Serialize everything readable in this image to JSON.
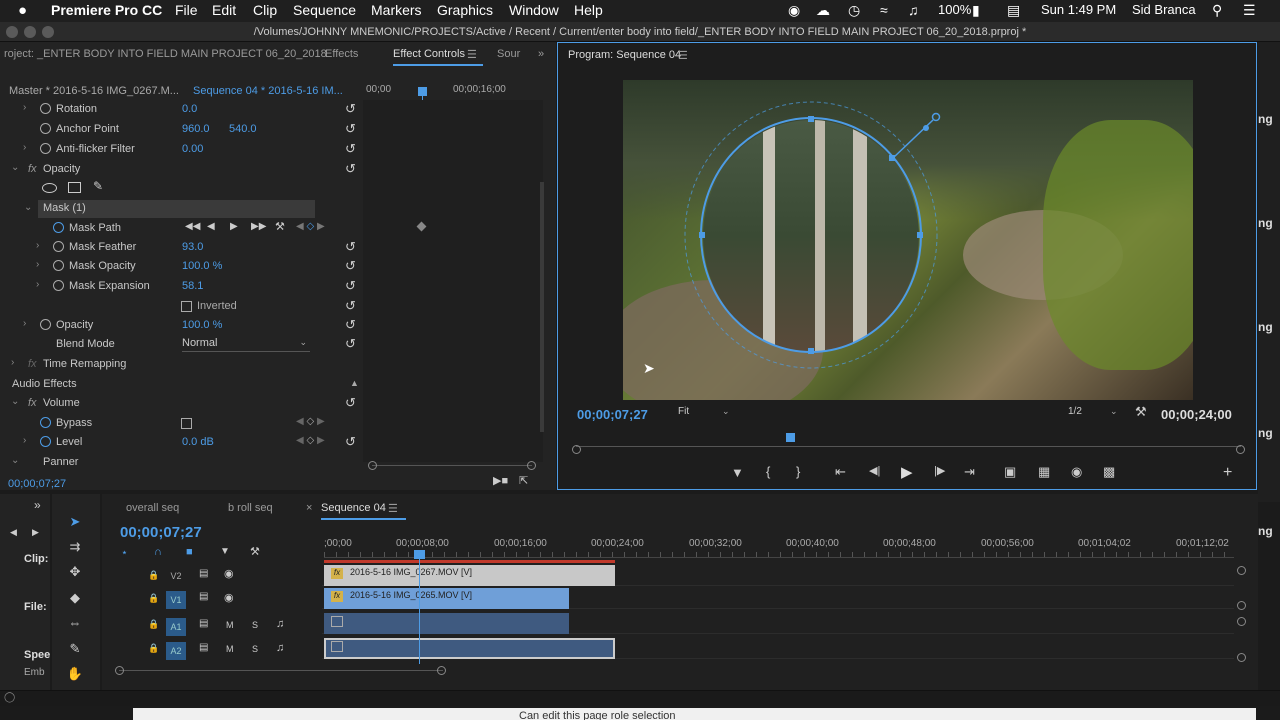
{
  "menubar": {
    "apple": "",
    "app": "Premiere Pro CC",
    "items": [
      "File",
      "Edit",
      "Clip",
      "Sequence",
      "Markers",
      "Graphics",
      "Window",
      "Help"
    ],
    "battery": "100%",
    "clock": "Sun 1:49 PM",
    "user": "Sid Branca"
  },
  "window": {
    "path": "/Volumes/JOHNNY MNEMONIC/PROJECTS/Active / Recent / Current/enter body into field/_ENTER BODY INTO FIELD MAIN PROJECT 06_20_2018.prproj *"
  },
  "left_tabs": {
    "project": "roject: _ENTER BODY INTO FIELD MAIN PROJECT 06_20_2018",
    "effects": "Effects",
    "effect_controls": "Effect Controls",
    "source": "Sour"
  },
  "ec": {
    "master": "Master * 2016-5-16 IMG_0267.M...",
    "sequence": "Sequence 04 * 2016-5-16 IM...",
    "ruler_start": "00;00",
    "ruler_mid": "00;00;16;00",
    "rotation_label": "Rotation",
    "rotation_val": "0.0",
    "anchor_label": "Anchor Point",
    "anchor_x": "960.0",
    "anchor_y": "540.0",
    "antiflicker_label": "Anti-flicker Filter",
    "antiflicker_val": "0.00",
    "opacity_fx_label": "Opacity",
    "mask_label": "Mask (1)",
    "mask_path_label": "Mask Path",
    "mask_feather_label": "Mask Feather",
    "mask_feather_val": "93.0",
    "mask_opacity_label": "Mask Opacity",
    "mask_opacity_val": "100.0 %",
    "mask_expansion_label": "Mask Expansion",
    "mask_expansion_val": "58.1",
    "inverted_label": "Inverted",
    "opacity_label": "Opacity",
    "opacity_val": "100.0 %",
    "blend_label": "Blend Mode",
    "blend_val": "Normal",
    "time_remap_label": "Time Remapping",
    "audio_effects_label": "Audio Effects",
    "volume_label": "Volume",
    "bypass_label": "Bypass",
    "level_label": "Level",
    "level_val": "0.0 dB",
    "panner_label": "Panner",
    "timecode": "00;00;07;27"
  },
  "program": {
    "title": "Program: Sequence 04",
    "timecode": "00;00;07;27",
    "fit": "Fit",
    "res": "1/2",
    "duration": "00;00;24;00"
  },
  "timeline": {
    "tabs": [
      "overall seq",
      "b roll seq",
      "Sequence 04"
    ],
    "timecode": "00;00;07;27",
    "ruler": [
      ";00;00",
      "00;00;08;00",
      "00;00;16;00",
      "00;00;24;00",
      "00;00;32;00",
      "00;00;40;00",
      "00;00;48;00",
      "00;00;56;00",
      "00;01;04;02",
      "00;01;12;02"
    ],
    "tracks": [
      "V2",
      "V1",
      "A1",
      "A2"
    ],
    "clip_v2": "2016-5-16 IMG_0267.MOV [V]",
    "clip_v1": "2016-5-16 IMG_0265.MOV [V]"
  },
  "project_strip": {
    "clip": "Clip:",
    "file": "File:",
    "speed": "Spee",
    "emb": "Emb"
  },
  "right_strip": [
    "ng",
    "ng",
    "ng",
    "ng",
    "ng"
  ],
  "bottom_hint": "Can edit this page role selection",
  "colors": {
    "accent": "#4d9ce6",
    "clip_v2": "#c8c8c8",
    "clip_v1": "#6f9fd8",
    "clip_audio": "#3f5a80",
    "playhead": "#4d9ce6"
  }
}
